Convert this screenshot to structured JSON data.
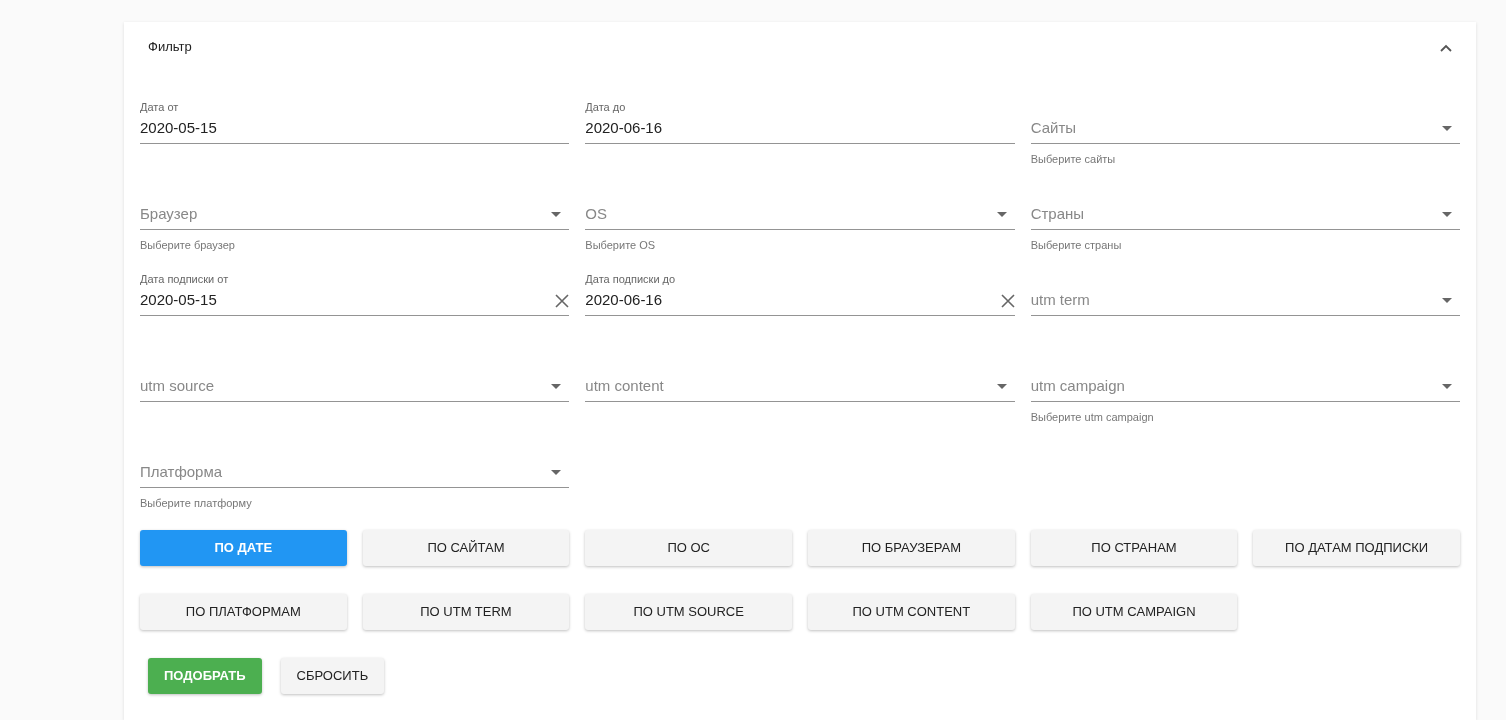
{
  "panel": {
    "title": "Фильтр",
    "expanded": true
  },
  "fields": [
    {
      "kind": "date",
      "label": "Дата от",
      "value": "2020-05-15",
      "clearable": false
    },
    {
      "kind": "date",
      "label": "Дата до",
      "value": "2020-06-16",
      "clearable": false
    },
    {
      "kind": "select",
      "placeholder": "Сайты",
      "hint": "Выберите сайты"
    },
    {
      "kind": "select",
      "placeholder": "Браузер",
      "hint": "Выберите браузер"
    },
    {
      "kind": "select",
      "placeholder": "OS",
      "hint": "Выберите OS"
    },
    {
      "kind": "select",
      "placeholder": "Страны",
      "hint": "Выберите страны"
    },
    {
      "kind": "date",
      "label": "Дата подписки от",
      "value": "2020-05-15",
      "clearable": true
    },
    {
      "kind": "date",
      "label": "Дата подписки до",
      "value": "2020-06-16",
      "clearable": true
    },
    {
      "kind": "select",
      "placeholder": "utm term"
    },
    {
      "kind": "select",
      "placeholder": "utm source"
    },
    {
      "kind": "select",
      "placeholder": "utm content"
    },
    {
      "kind": "select",
      "placeholder": "utm campaign",
      "hint": "Выберите utm campaign"
    },
    {
      "kind": "select",
      "placeholder": "Платформа",
      "hint": "Выберите платформу"
    }
  ],
  "group_buttons": [
    {
      "label": "ПО ДАТЕ",
      "selected": true
    },
    {
      "label": "ПО САЙТАМ",
      "selected": false
    },
    {
      "label": "ПО ОС",
      "selected": false
    },
    {
      "label": "ПО БРАУЗЕРАМ",
      "selected": false
    },
    {
      "label": "ПО СТРАНАМ",
      "selected": false
    },
    {
      "label": "ПО ДАТАМ ПОДПИСКИ",
      "selected": false
    },
    {
      "label": "ПО ПЛАТФОРМАМ",
      "selected": false
    },
    {
      "label": "ПО UTM TERM",
      "selected": false
    },
    {
      "label": "ПО UTM SOURCE",
      "selected": false
    },
    {
      "label": "ПО UTM CONTENT",
      "selected": false
    },
    {
      "label": "ПО UTM CAMPAIGN",
      "selected": false
    }
  ],
  "actions": [
    {
      "label": "ПОДОБРАТЬ",
      "kind": "primary"
    },
    {
      "label": "СБРОСИТЬ",
      "kind": "secondary"
    }
  ]
}
